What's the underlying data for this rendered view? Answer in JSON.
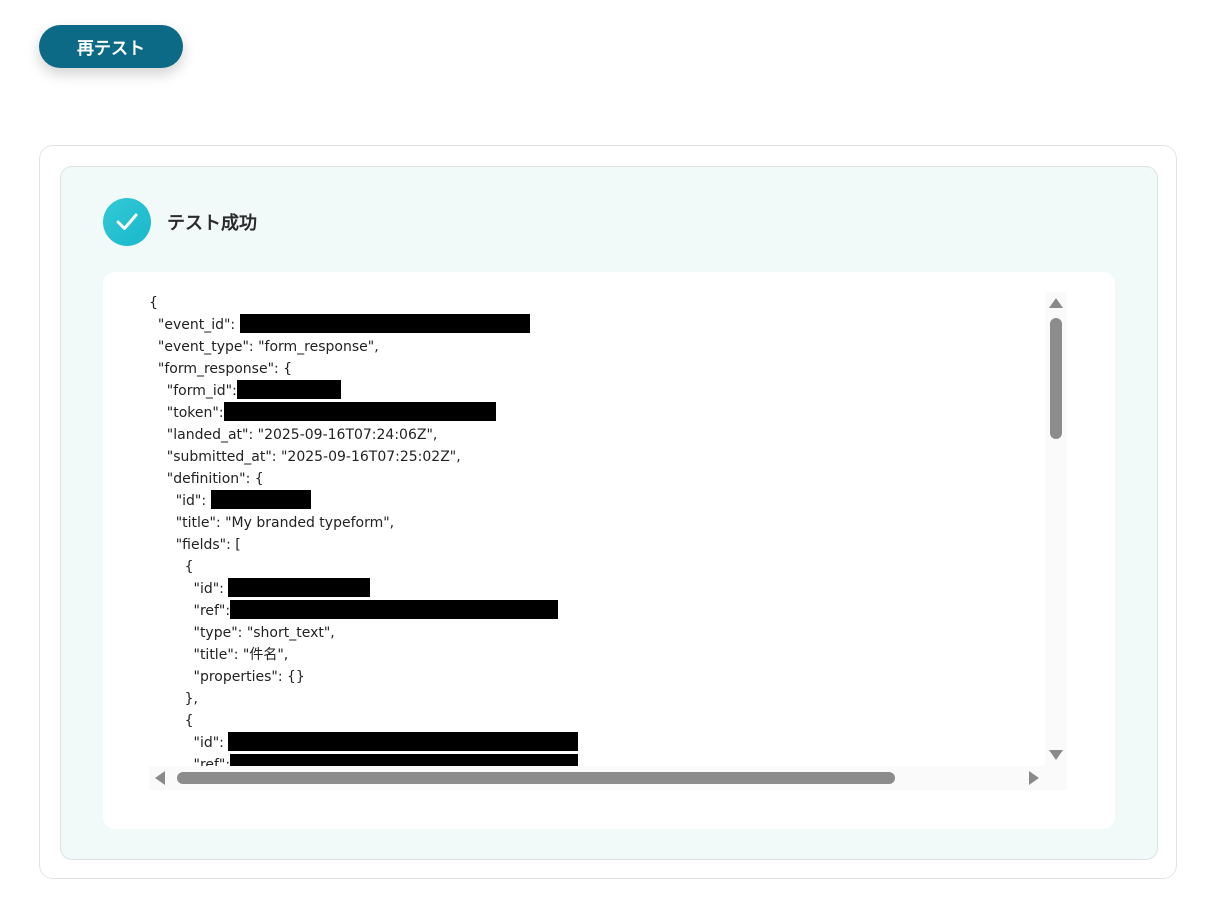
{
  "header": {
    "retest_label": "再テスト"
  },
  "status": {
    "label": "テスト成功",
    "icon": "check-circle-icon",
    "accent_color": "#1fbfd0"
  },
  "code_lines": [
    {
      "pre": "{",
      "redact": 0,
      "post": ""
    },
    {
      "pre": "  \"event_id\": ",
      "redact": 290,
      "post": ""
    },
    {
      "pre": "  \"event_type\": \"form_response\",",
      "redact": 0,
      "post": ""
    },
    {
      "pre": "  \"form_response\": {",
      "redact": 0,
      "post": ""
    },
    {
      "pre": "    \"form_id\":",
      "redact": 104,
      "post": ""
    },
    {
      "pre": "    \"token\":",
      "redact": 272,
      "post": ""
    },
    {
      "pre": "    \"landed_at\": \"2025-09-16T07:24:06Z\",",
      "redact": 0,
      "post": ""
    },
    {
      "pre": "    \"submitted_at\": \"2025-09-16T07:25:02Z\",",
      "redact": 0,
      "post": ""
    },
    {
      "pre": "    \"definition\": {",
      "redact": 0,
      "post": ""
    },
    {
      "pre": "      \"id\": ",
      "redact": 100,
      "post": ""
    },
    {
      "pre": "      \"title\": \"My branded typeform\",",
      "redact": 0,
      "post": ""
    },
    {
      "pre": "      \"fields\": [",
      "redact": 0,
      "post": ""
    },
    {
      "pre": "        {",
      "redact": 0,
      "post": ""
    },
    {
      "pre": "          \"id\": ",
      "redact": 142,
      "post": ""
    },
    {
      "pre": "          \"ref\":",
      "redact": 328,
      "post": ""
    },
    {
      "pre": "          \"type\": \"short_text\",",
      "redact": 0,
      "post": ""
    },
    {
      "pre": "          \"title\": \"件名\",",
      "redact": 0,
      "post": ""
    },
    {
      "pre": "          \"properties\": {}",
      "redact": 0,
      "post": ""
    },
    {
      "pre": "        },",
      "redact": 0,
      "post": ""
    },
    {
      "pre": "        {",
      "redact": 0,
      "post": ""
    },
    {
      "pre": "          \"id\": ",
      "redact": 350,
      "post": ""
    },
    {
      "pre": "          \"ref\":",
      "redact": 348,
      "post": ""
    }
  ]
}
